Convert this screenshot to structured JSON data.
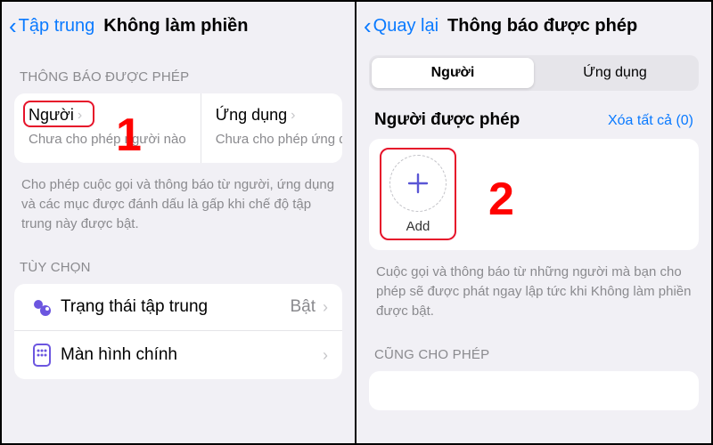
{
  "left": {
    "back": "Tập trung",
    "title": "Không làm phiền",
    "section_allowed": "THÔNG BÁO ĐƯỢC PHÉP",
    "people": {
      "label": "Người",
      "sub": "Chưa cho phép người nào"
    },
    "apps": {
      "label": "Ứng dụng",
      "sub": "Chưa cho phép ứng dụn..."
    },
    "allowed_footnote": "Cho phép cuộc gọi và thông báo từ người, ứng dụng và các mục được đánh dấu là gấp khi chế độ tập trung này được bật.",
    "section_options": "TÙY CHỌN",
    "rows": {
      "focus_status": {
        "label": "Trạng thái tập trung",
        "value": "Bật"
      },
      "home_screen": {
        "label": "Màn hình chính"
      }
    },
    "marker": "1"
  },
  "right": {
    "back": "Quay lại",
    "title": "Thông báo được phép",
    "seg": {
      "people": "Người",
      "apps": "Ứng dụng"
    },
    "allowed_people_label": "Người được phép",
    "clear_all": "Xóa tất cả (0)",
    "add_label": "Add",
    "footnote": "Cuộc gọi và thông báo từ những người mà bạn cho phép sẽ được phát ngay lập tức khi Không làm phiền được bật.",
    "section_also": "CŨNG CHO PHÉP",
    "marker": "2"
  }
}
